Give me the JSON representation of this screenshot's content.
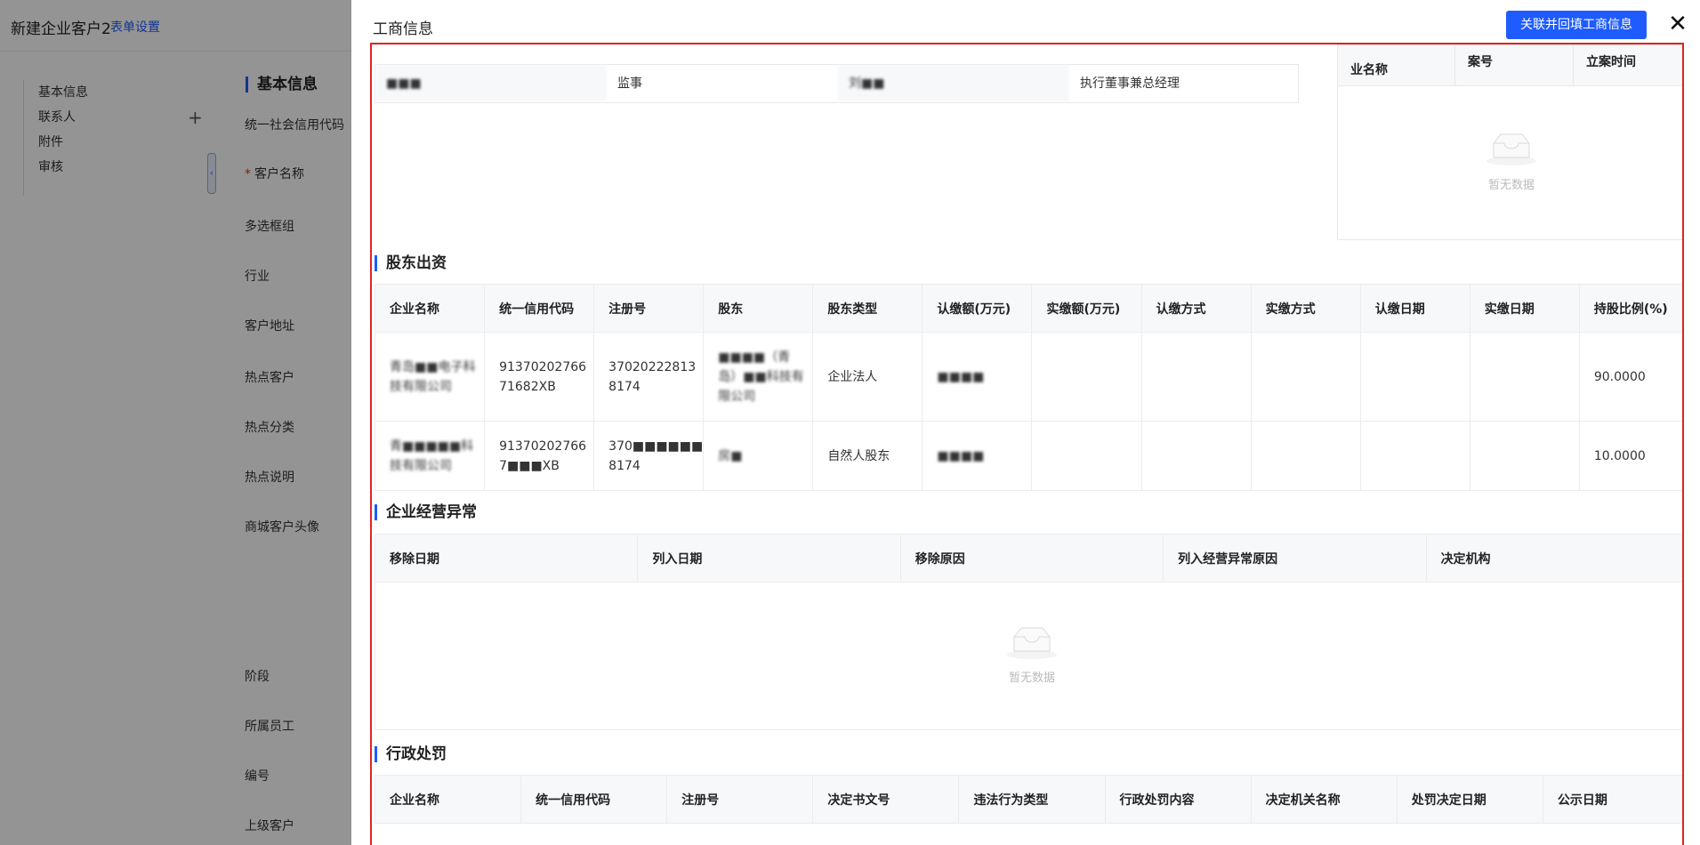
{
  "background": {
    "title": "新建企业客户2",
    "settings_link": "表单设置",
    "nav": [
      "基本信息",
      "联系人",
      "附件",
      "审核"
    ],
    "nav_add_icon": "plus-icon",
    "section_title": "基本信息",
    "fields": [
      "统一社会信用代码",
      "客户名称",
      "多选框组",
      "行业",
      "客户地址",
      "热点客户",
      "热点分类",
      "热点说明",
      "商城客户头像",
      "阶段",
      "所属员工",
      "编号",
      "上级客户"
    ],
    "required_mark": "*"
  },
  "drawer": {
    "title": "工商信息",
    "primary_button": "关联并回填工商信息",
    "close_icon": "✕",
    "accent_color": "#1f5cff",
    "highlight_color": "#e02424"
  },
  "members": {
    "row": [
      "■■■",
      "监事",
      "刘■■",
      "执行董事兼总经理"
    ]
  },
  "litigation": {
    "headers": [
      "业名称",
      "案号",
      "立案时间"
    ],
    "empty_text": "暂无数据"
  },
  "shareholders": {
    "title": "股东出资",
    "headers": [
      "企业名称",
      "统一信用代码",
      "注册号",
      "股东",
      "股东类型",
      "认缴额(万元)",
      "实缴额(万元)",
      "认缴方式",
      "实缴方式",
      "认缴日期",
      "实缴日期",
      "持股比例(%)"
    ],
    "rows": [
      [
        "青岛■■电子科技有限公司",
        "91370202766 71682XB",
        "37020222813 8174",
        "■■■■（青岛）■■科技有限公司",
        "企业法人",
        "■■■■",
        "",
        "",
        "",
        "",
        "",
        "90.0000"
      ],
      [
        "青■■■■■科技有限公司",
        "91370202766 7■■■XB",
        "370■■■■■■ 8174",
        "房■",
        "自然人股东",
        "■■■■",
        "",
        "",
        "",
        "",
        "",
        "10.0000"
      ]
    ]
  },
  "abnormal": {
    "title": "企业经营异常",
    "headers": [
      "移除日期",
      "列入日期",
      "移除原因",
      "列入经营异常原因",
      "决定机构"
    ],
    "empty_text": "暂无数据"
  },
  "penalty": {
    "title": "行政处罚",
    "headers": [
      "企业名称",
      "统一信用代码",
      "注册号",
      "决定书文号",
      "违法行为类型",
      "行政处罚内容",
      "决定机关名称",
      "处罚决定日期",
      "公示日期"
    ]
  }
}
